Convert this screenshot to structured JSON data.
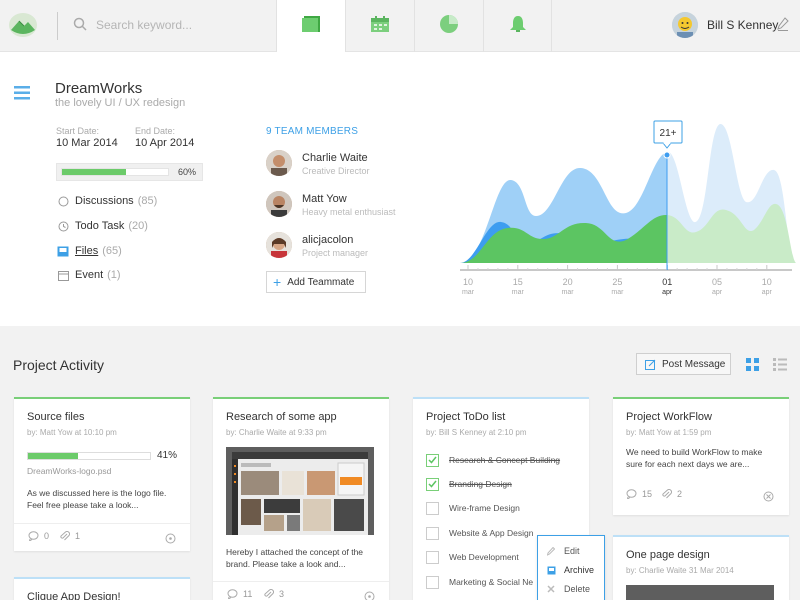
{
  "header": {
    "search_placeholder": "Search keyword...",
    "tabs": [
      {
        "icon": "dashboard-icon",
        "active": true
      },
      {
        "icon": "calendar-icon",
        "active": false
      },
      {
        "icon": "pie-chart-icon",
        "active": false
      },
      {
        "icon": "bell-icon",
        "active": false
      }
    ],
    "user_name": "Bill S Kenney"
  },
  "project": {
    "title": "DreamWorks",
    "subtitle": "the lovely UI / UX redesign",
    "start_label": "Start Date:",
    "start_date": "10 Mar 2014",
    "end_label": "End Date:",
    "end_date": "10 Apr 2014",
    "progress_pct": 60,
    "progress_text": "60%",
    "nav": [
      {
        "label": "Discussions",
        "count": "(85)",
        "icon": "circle-icon"
      },
      {
        "label": "Todo Task",
        "count": "(20)",
        "icon": "clock-icon"
      },
      {
        "label": "Files",
        "count": "(65)",
        "icon": "tray-icon"
      },
      {
        "label": "Event",
        "count": "(1)",
        "icon": "calendar-icon"
      }
    ]
  },
  "team": {
    "title": "9 TEAM MEMBERS",
    "members": [
      {
        "name": "Charlie Waite",
        "role": "Creative Director"
      },
      {
        "name": "Matt Yow",
        "role": "Heavy metal enthusiast"
      },
      {
        "name": "alicjacolon",
        "role": "Project manager"
      }
    ],
    "add_label": "Add Teammate"
  },
  "chart_data": {
    "type": "area",
    "callout": "21+",
    "ticks": [
      {
        "day": "10",
        "month": "mar"
      },
      {
        "day": "15",
        "month": "mar"
      },
      {
        "day": "20",
        "month": "mar"
      },
      {
        "day": "25",
        "month": "mar"
      },
      {
        "day": "01",
        "month": "apr"
      },
      {
        "day": "05",
        "month": "apr"
      },
      {
        "day": "10",
        "month": "apr"
      }
    ],
    "highlight_index": 4,
    "colors": {
      "back": "#9fd0f7",
      "mid": "#3d9df0",
      "front": "#5cc562",
      "faded_back": "#dcecfa",
      "faded_front": "#c9ebc8"
    }
  },
  "activity": {
    "title": "Project Activity",
    "post_label": "Post Message",
    "cards": {
      "source": {
        "title": "Source files",
        "byline": "by: Matt Yow at 10:10 pm",
        "progress_pct": 41,
        "progress_text": "41%",
        "file": "DreamWorks-logo.psd",
        "body": "As we discussed here is the logo file. Feel free please take a look...",
        "comments": "0",
        "attachments": "1"
      },
      "research": {
        "title": "Research of some app",
        "byline": "by: Charlie Waite at 9:33 pm",
        "body": "Hereby I attached the concept of the brand. Please take a look and...",
        "comments": "11",
        "attachments": "3"
      },
      "todo": {
        "title": "Project ToDo list",
        "byline": "by: Bill S Kenney at 2:10 pm",
        "items": [
          {
            "text": "Research & Concept Building",
            "done": true
          },
          {
            "text": "Branding Design",
            "done": true
          },
          {
            "text": "Wire-frame Design",
            "done": false
          },
          {
            "text": "Website & App Design",
            "done": false
          },
          {
            "text": "Web Development",
            "done": false
          },
          {
            "text": "Marketing & Social Ne",
            "done": false
          }
        ]
      },
      "workflow": {
        "title": "Project WorkFlow",
        "byline": "by: Matt Yow at 1:59 pm",
        "body": "We need to build WorkFlow to make sure for each next days we are...",
        "comments": "15",
        "attachments": "2"
      },
      "onepage": {
        "title": "One page design",
        "byline": "by: Charlie Waite 31 Mar 2014"
      },
      "clique": {
        "title": "Clique App Design!"
      }
    },
    "context_menu": [
      {
        "label": "Edit",
        "icon": "pencil-icon"
      },
      {
        "label": "Archive",
        "icon": "archive-icon"
      },
      {
        "label": "Delete",
        "icon": "close-icon"
      }
    ]
  }
}
